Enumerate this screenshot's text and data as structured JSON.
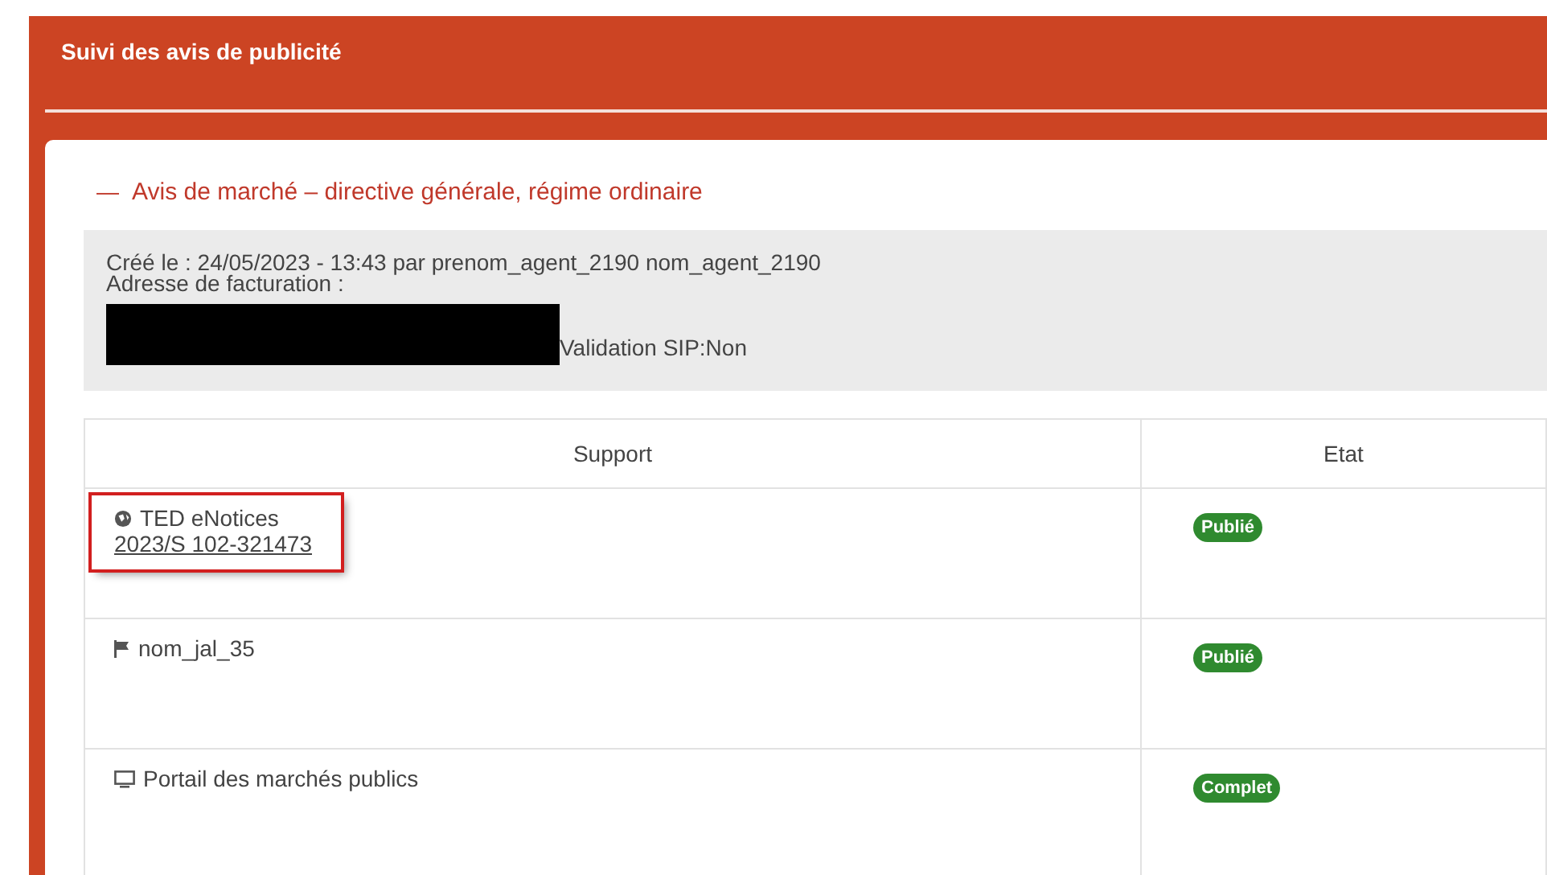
{
  "panel": {
    "title": "Suivi des avis de publicité"
  },
  "section": {
    "toggle": "—",
    "title": "Avis de marché – directive générale, régime ordinaire",
    "expanded": true
  },
  "info": {
    "created": "Créé le : 24/05/2023 - 13:43 par prenom_agent_2190 nom_agent_2190",
    "billing_label": "Adresse de facturation :",
    "validation": "Validation SIP:Non"
  },
  "table": {
    "columns": [
      "Support",
      "Etat"
    ],
    "rows": [
      {
        "kind": "globe",
        "support": "TED eNotices",
        "reference": "2023/S 102-321473",
        "status": "Publié",
        "highlighted": true
      },
      {
        "kind": "flag",
        "support": "nom_jal_35",
        "status": "Publié",
        "highlighted": false
      },
      {
        "kind": "monitor",
        "support": "Portail des marchés publics",
        "status": "Complet",
        "highlighted": false
      }
    ]
  }
}
